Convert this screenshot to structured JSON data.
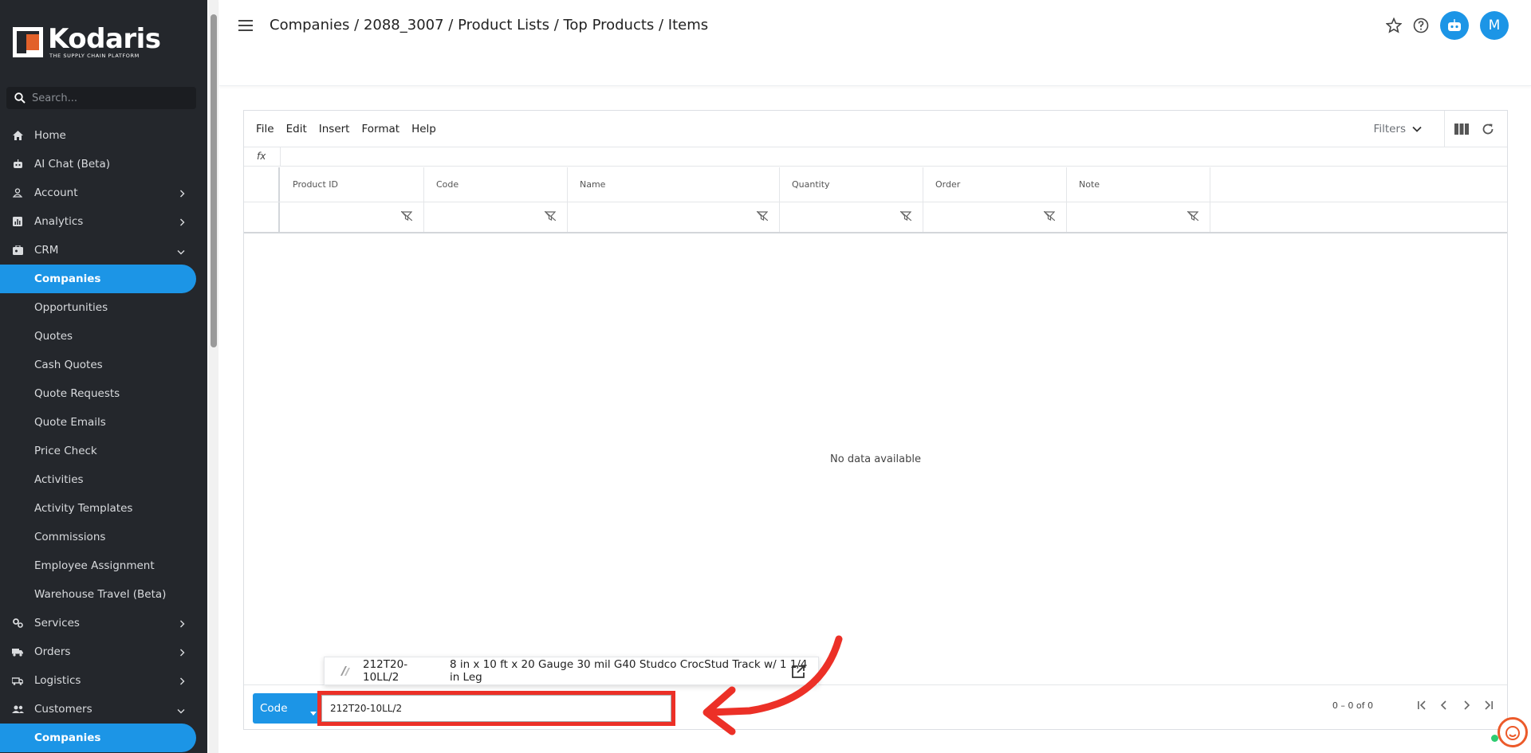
{
  "brand": {
    "name": "Kodaris",
    "tagline": "THE SUPPLY CHAIN PLATFORM"
  },
  "sidebar": {
    "search_placeholder": "Search...",
    "items": [
      {
        "label": "Home",
        "icon": "home-icon",
        "type": "top"
      },
      {
        "label": "AI Chat (Beta)",
        "icon": "bot-icon",
        "type": "top"
      },
      {
        "label": "Account",
        "icon": "person-icon",
        "type": "top",
        "chevron": "right"
      },
      {
        "label": "Analytics",
        "icon": "analytics-icon",
        "type": "top",
        "chevron": "right"
      },
      {
        "label": "CRM",
        "icon": "crm-icon",
        "type": "top",
        "chevron": "down"
      },
      {
        "label": "Companies",
        "type": "sub",
        "active": true
      },
      {
        "label": "Opportunities",
        "type": "sub"
      },
      {
        "label": "Quotes",
        "type": "sub"
      },
      {
        "label": "Cash Quotes",
        "type": "sub"
      },
      {
        "label": "Quote Requests",
        "type": "sub"
      },
      {
        "label": "Quote Emails",
        "type": "sub"
      },
      {
        "label": "Price Check",
        "type": "sub"
      },
      {
        "label": "Activities",
        "type": "sub"
      },
      {
        "label": "Activity Templates",
        "type": "sub"
      },
      {
        "label": "Commissions",
        "type": "sub"
      },
      {
        "label": "Employee Assignment",
        "type": "sub"
      },
      {
        "label": "Warehouse Travel (Beta)",
        "type": "sub"
      },
      {
        "label": "Services",
        "icon": "services-icon",
        "type": "top",
        "chevron": "right"
      },
      {
        "label": "Orders",
        "icon": "truck-icon",
        "type": "top",
        "chevron": "right"
      },
      {
        "label": "Logistics",
        "icon": "logistics-icon",
        "type": "top",
        "chevron": "right"
      },
      {
        "label": "Customers",
        "icon": "people-icon",
        "type": "top",
        "chevron": "down"
      },
      {
        "label": "Companies",
        "type": "sub",
        "active": true
      }
    ]
  },
  "header": {
    "breadcrumb": "Companies / 2088_3007 / Product Lists / Top Products / Items",
    "avatar_initial": "M"
  },
  "grid": {
    "menu": [
      "File",
      "Edit",
      "Insert",
      "Format",
      "Help"
    ],
    "filters_label": "Filters",
    "fx_label": "fx",
    "columns": [
      "Product ID",
      "Code",
      "Name",
      "Quantity",
      "Order",
      "Note"
    ],
    "empty_message": "No data available",
    "footer": {
      "mode_button": "Code",
      "input_value": "212T20-10LL/2",
      "page_count": "0 – 0 of 0"
    },
    "suggestion": {
      "code": "212T20-10LL/2",
      "description": "8 in x 10 ft x 20 Gauge 30 mil G40 Studco CrocStud Track w/ 1 1/4 in Leg"
    }
  },
  "colors": {
    "accent": "#1c95e6",
    "sidebar": "#24272c",
    "annotation": "#ec3027"
  }
}
